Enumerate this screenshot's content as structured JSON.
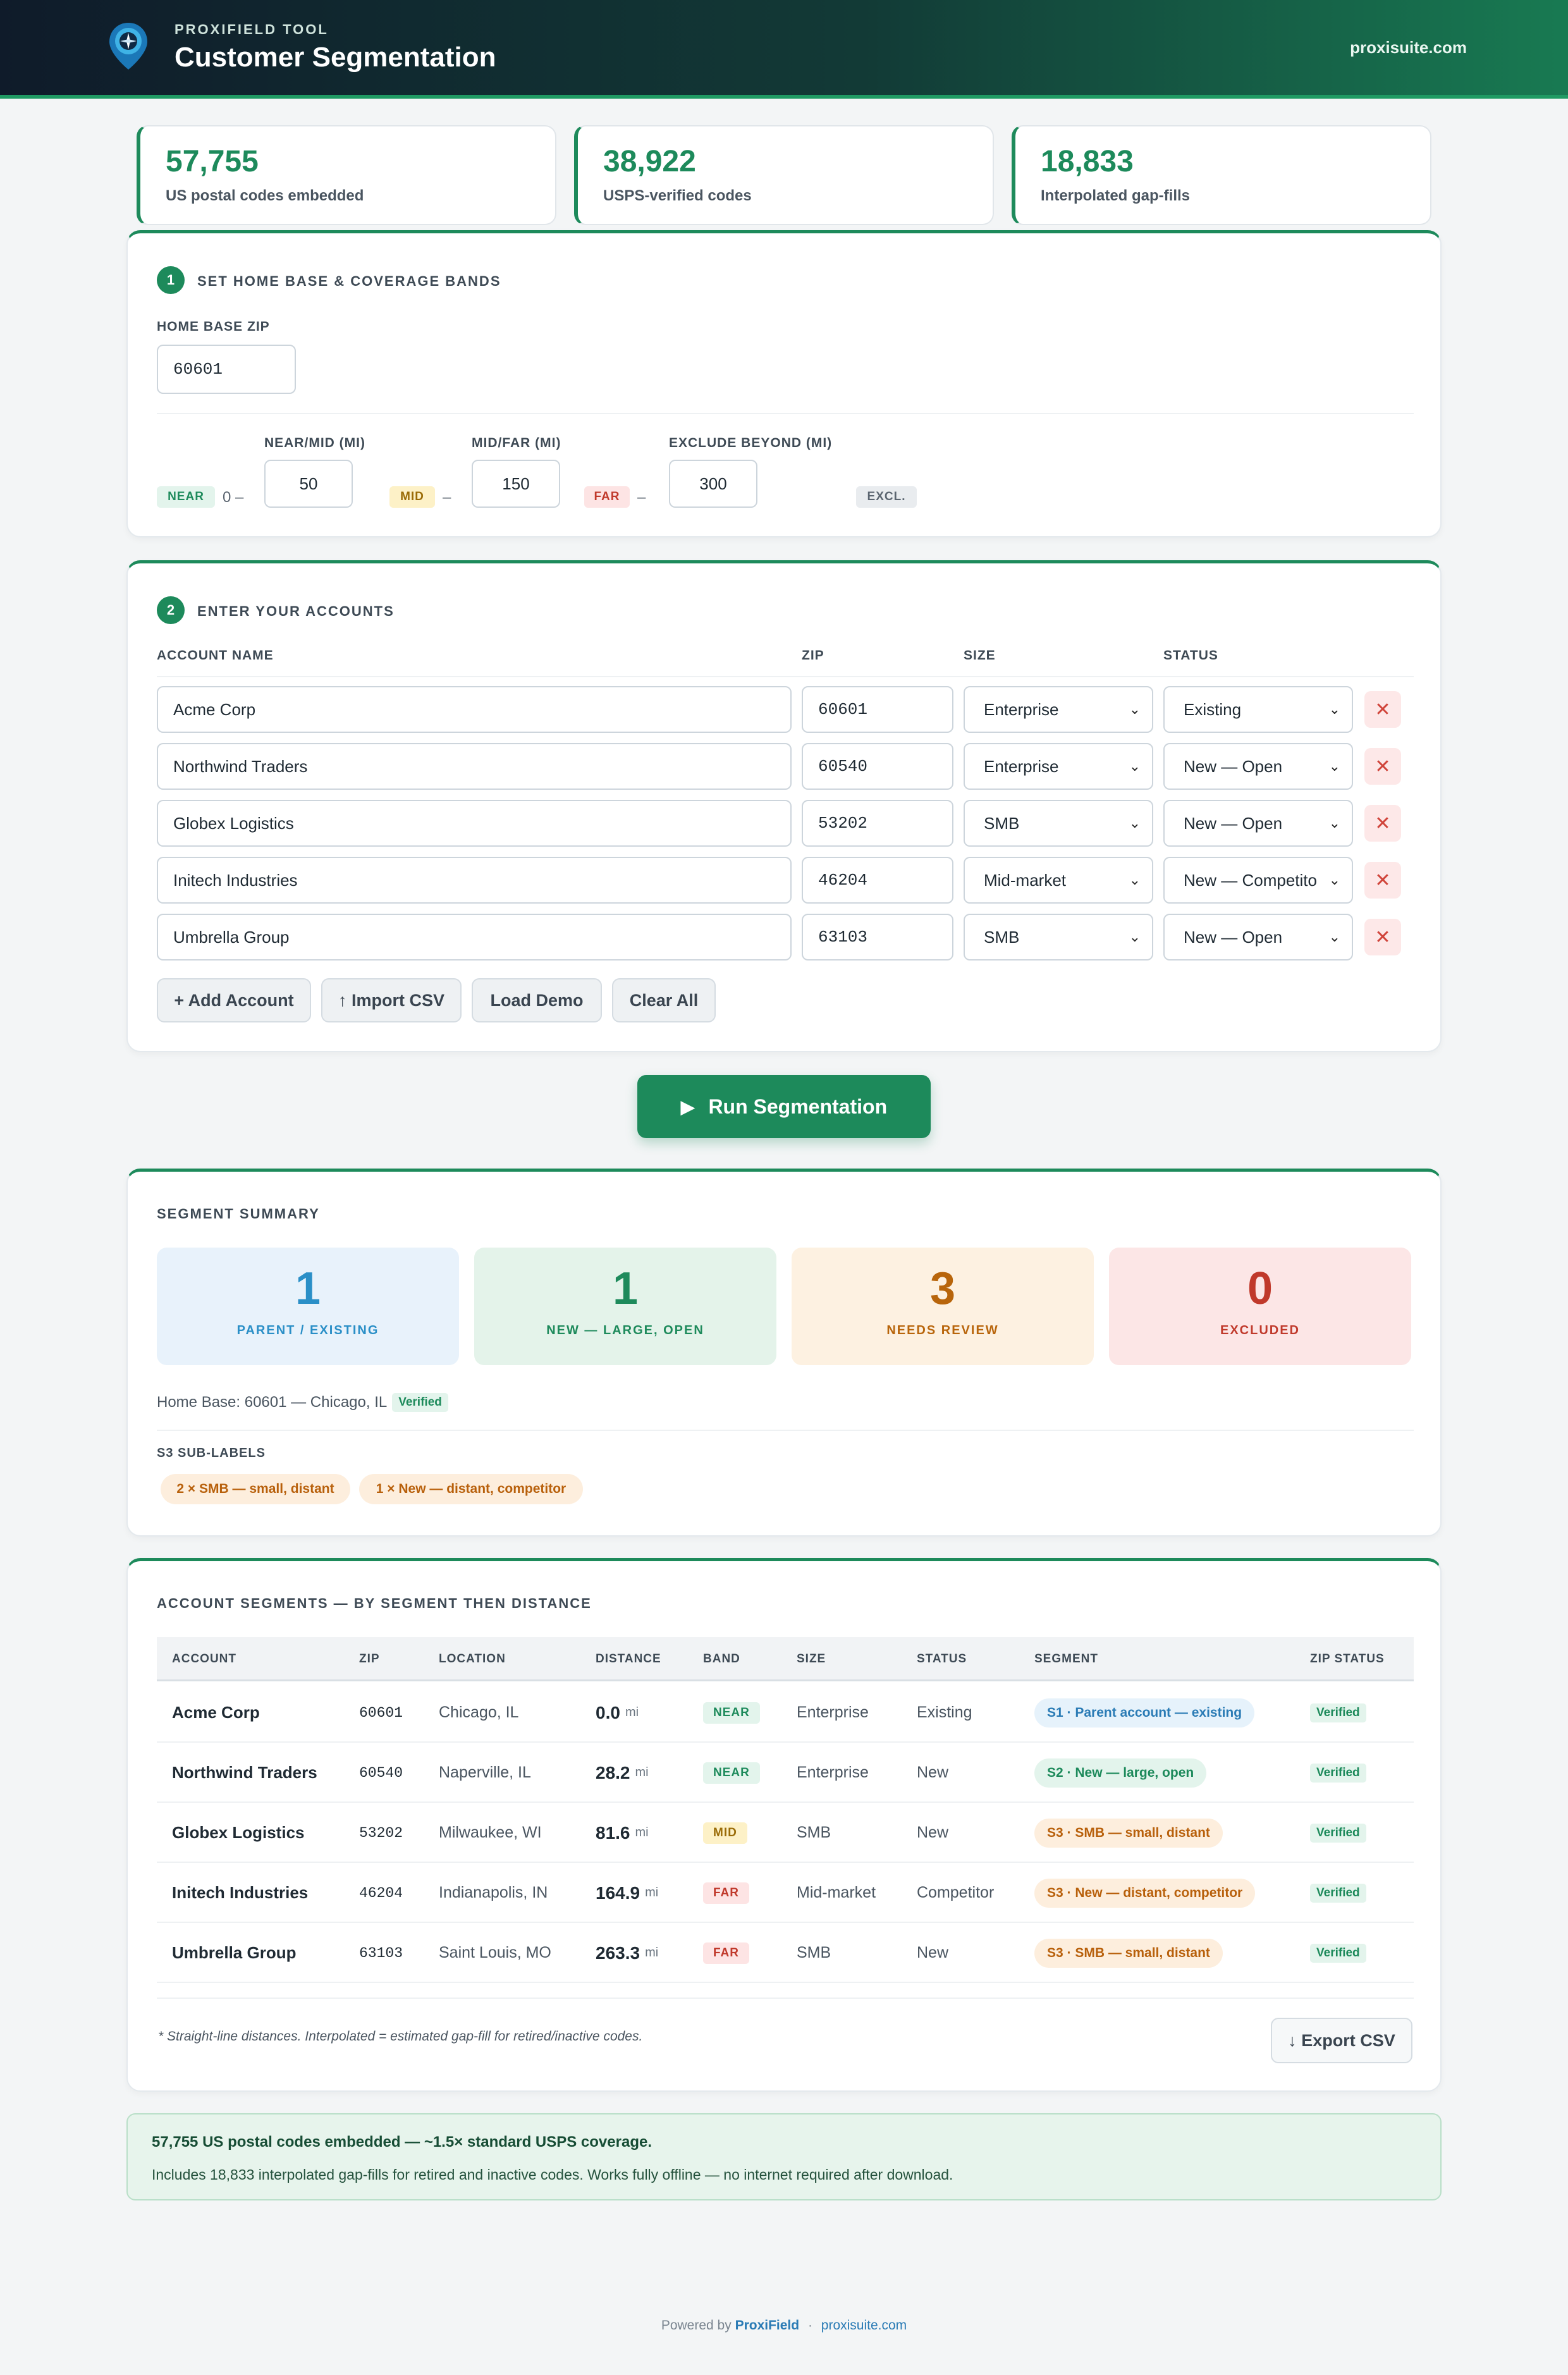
{
  "header": {
    "kicker": "PROXIFIELD TOOL",
    "title": "Customer Segmentation",
    "site": "proxisuite.com",
    "logo_icon": "map-pin-compass-icon"
  },
  "stats": [
    {
      "value": "57,755",
      "label": "US postal codes embedded"
    },
    {
      "value": "38,922",
      "label": "USPS-verified codes"
    },
    {
      "value": "18,833",
      "label": "Interpolated gap-fills"
    }
  ],
  "step1": {
    "number": "1",
    "title": "SET HOME BASE & COVERAGE BANDS",
    "home_zip_label": "HOME BASE ZIP",
    "home_zip_value": "60601",
    "bands": {
      "near_label": "NEAR",
      "near_start": "0 –",
      "near_mid_label": "NEAR/MID (MI)",
      "near_mid_value": "50",
      "mid_label": "MID",
      "mid_dash": "–",
      "mid_far_label": "MID/FAR (MI)",
      "mid_far_value": "150",
      "far_label": "FAR",
      "far_dash": "–",
      "exclude_label": "EXCLUDE BEYOND (MI)",
      "exclude_value": "300",
      "excl_label": "EXCL."
    }
  },
  "step2": {
    "number": "2",
    "title": "ENTER YOUR ACCOUNTS",
    "columns": {
      "name": "ACCOUNT NAME",
      "zip": "ZIP",
      "size": "SIZE",
      "status": "STATUS"
    },
    "rows": [
      {
        "name": "Acme Corp",
        "zip": "60601",
        "size": "Enterprise",
        "status": "Existing"
      },
      {
        "name": "Northwind Traders",
        "zip": "60540",
        "size": "Enterprise",
        "status": "New — Open"
      },
      {
        "name": "Globex Logistics",
        "zip": "53202",
        "size": "SMB",
        "status": "New — Open"
      },
      {
        "name": "Initech Industries",
        "zip": "46204",
        "size": "Mid-market",
        "status": "New — Competito"
      },
      {
        "name": "Umbrella Group",
        "zip": "63103",
        "size": "SMB",
        "status": "New — Open"
      }
    ],
    "delete_glyph": "✕",
    "buttons": {
      "add": "+ Add Account",
      "import": "↑ Import CSV",
      "demo": "Load Demo",
      "clear": "Clear All"
    }
  },
  "run_button": {
    "icon": "▶",
    "label": "Run Segmentation"
  },
  "summary": {
    "title": "SEGMENT SUMMARY",
    "cards": [
      {
        "value": "1",
        "label": "PARENT / EXISTING",
        "color": "#2a8fc7",
        "bg": "#e8f2fb"
      },
      {
        "value": "1",
        "label": "NEW — LARGE, OPEN",
        "color": "#1d8a5b",
        "bg": "#e4f3ea"
      },
      {
        "value": "3",
        "label": "NEEDS REVIEW",
        "color": "#b8650b",
        "bg": "#fdf1e1"
      },
      {
        "value": "0",
        "label": "EXCLUDED",
        "color": "#c0392b",
        "bg": "#fce6e6"
      }
    ],
    "home_base_text": "Home Base: 60601 — Chicago, IL",
    "verified_label": "Verified",
    "sub_labels_title": "S3 SUB-LABELS",
    "sub_labels": [
      "2 × SMB — small, distant",
      "1 × New — distant, competitor"
    ]
  },
  "segments": {
    "title": "ACCOUNT SEGMENTS — BY SEGMENT THEN DISTANCE",
    "columns": [
      "ACCOUNT",
      "ZIP",
      "LOCATION",
      "DISTANCE",
      "BAND",
      "SIZE",
      "STATUS",
      "SEGMENT",
      "ZIP STATUS"
    ],
    "unit": "mi",
    "rows": [
      {
        "account": "Acme Corp",
        "zip": "60601",
        "location": "Chicago, IL",
        "distance": "0.0",
        "band": "NEAR",
        "size": "Enterprise",
        "status": "Existing",
        "segment": "S1 · Parent account — existing",
        "zip_status": "Verified"
      },
      {
        "account": "Northwind Traders",
        "zip": "60540",
        "location": "Naperville, IL",
        "distance": "28.2",
        "band": "NEAR",
        "size": "Enterprise",
        "status": "New",
        "segment": "S2 · New — large, open",
        "zip_status": "Verified"
      },
      {
        "account": "Globex Logistics",
        "zip": "53202",
        "location": "Milwaukee, WI",
        "distance": "81.6",
        "band": "MID",
        "size": "SMB",
        "status": "New",
        "segment": "S3 · SMB — small, distant",
        "zip_status": "Verified"
      },
      {
        "account": "Initech Industries",
        "zip": "46204",
        "location": "Indianapolis, IN",
        "distance": "164.9",
        "band": "FAR",
        "size": "Mid-market",
        "status": "Competitor",
        "segment": "S3 · New — distant, competitor",
        "zip_status": "Verified"
      },
      {
        "account": "Umbrella Group",
        "zip": "63103",
        "location": "Saint Louis, MO",
        "distance": "263.3",
        "band": "FAR",
        "size": "SMB",
        "status": "New",
        "segment": "S3 · SMB — small, distant",
        "zip_status": "Verified"
      }
    ],
    "footnote": "* Straight-line distances. Interpolated = estimated gap-fill for retired/inactive codes.",
    "export_label": "↓ Export CSV"
  },
  "note": {
    "line1": "57,755 US postal codes embedded — ~1.5× standard USPS coverage.",
    "line2": "Includes 18,833 interpolated gap-fills for retired and inactive codes. Works fully offline — no internet required after download."
  },
  "footer": {
    "prefix": "Powered by",
    "brand": "ProxiField",
    "sep": "·",
    "site": "proxisuite.com"
  }
}
